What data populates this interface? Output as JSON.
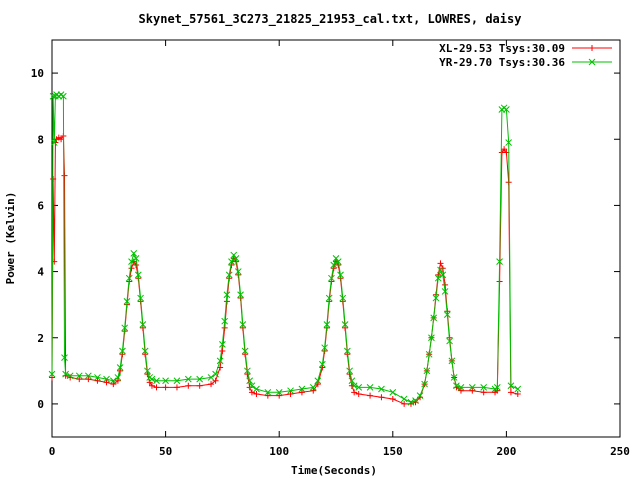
{
  "chart_data": {
    "type": "line",
    "title": "Skynet_57561_3C273_21825_21953_cal.txt, LOWRES, daisy",
    "xlabel": "Time(Seconds)",
    "ylabel": "Power (Kelvin)",
    "xlim": [
      0,
      250
    ],
    "ylim": [
      -1,
      11
    ],
    "xticks": [
      "0",
      "50",
      "100",
      "150",
      "200",
      "250"
    ],
    "yticks": [
      "0",
      "2",
      "4",
      "6",
      "8",
      "10"
    ],
    "legend_position": "top-right",
    "grid": false,
    "series": [
      {
        "name": "XL-29.53 Tsys:30.09",
        "color": "#ff0000",
        "marker": "plus",
        "x": [
          0,
          0.5,
          1,
          1.5,
          2,
          3,
          4,
          5,
          5.5,
          6,
          8,
          12,
          16,
          20,
          24,
          27,
          29,
          30,
          31,
          32,
          33,
          34,
          35,
          36,
          37,
          38,
          39,
          40,
          41,
          42,
          43,
          44,
          46,
          50,
          55,
          60,
          65,
          70,
          72,
          74,
          75,
          76,
          77,
          78,
          79,
          80,
          81,
          82,
          83,
          84,
          85,
          86,
          87,
          88,
          90,
          95,
          100,
          105,
          110,
          115,
          117,
          119,
          120,
          121,
          122,
          123,
          124,
          125,
          126,
          127,
          128,
          129,
          130,
          131,
          132,
          133,
          135,
          140,
          145,
          150,
          155,
          158,
          160,
          162,
          164,
          165,
          166,
          167,
          168,
          169,
          170,
          171,
          172,
          173,
          174,
          175,
          176,
          177,
          178,
          180,
          185,
          190,
          195,
          196,
          197,
          198,
          199,
          200,
          201,
          202,
          205
        ],
        "values": [
          0.8,
          6.8,
          4.3,
          7.9,
          8.0,
          8.05,
          8.0,
          8.1,
          6.9,
          0.85,
          0.8,
          0.75,
          0.75,
          0.7,
          0.65,
          0.6,
          0.7,
          1.0,
          1.5,
          2.2,
          3.0,
          3.7,
          4.1,
          4.3,
          4.2,
          3.8,
          3.1,
          2.3,
          1.5,
          0.9,
          0.65,
          0.55,
          0.5,
          0.5,
          0.5,
          0.55,
          0.55,
          0.6,
          0.7,
          1.1,
          1.6,
          2.3,
          3.1,
          3.8,
          4.2,
          4.4,
          4.3,
          3.9,
          3.2,
          2.3,
          1.5,
          0.9,
          0.5,
          0.35,
          0.3,
          0.25,
          0.25,
          0.3,
          0.35,
          0.4,
          0.6,
          1.1,
          1.6,
          2.3,
          3.1,
          3.7,
          4.1,
          4.3,
          4.2,
          3.8,
          3.1,
          2.3,
          1.5,
          0.9,
          0.55,
          0.35,
          0.3,
          0.25,
          0.2,
          0.15,
          0.0,
          0.0,
          0.05,
          0.2,
          0.6,
          1.0,
          1.5,
          2.0,
          2.6,
          3.3,
          3.9,
          4.25,
          4.1,
          3.6,
          2.8,
          2.0,
          1.3,
          0.8,
          0.5,
          0.4,
          0.4,
          0.35,
          0.35,
          0.4,
          3.7,
          7.6,
          7.7,
          7.6,
          6.7,
          0.35,
          0.3
        ]
      },
      {
        "name": "YR-29.70 Tsys:30.36",
        "color": "#00c000",
        "marker": "cross",
        "x": [
          0,
          0.5,
          1,
          1.5,
          2,
          3,
          4,
          5,
          5.5,
          6,
          8,
          12,
          16,
          20,
          24,
          27,
          29,
          30,
          31,
          32,
          33,
          34,
          35,
          36,
          37,
          38,
          39,
          40,
          41,
          42,
          43,
          44,
          46,
          50,
          55,
          60,
          65,
          70,
          72,
          74,
          75,
          76,
          77,
          78,
          79,
          80,
          81,
          82,
          83,
          84,
          85,
          86,
          87,
          88,
          90,
          95,
          100,
          105,
          110,
          115,
          117,
          119,
          120,
          121,
          122,
          123,
          124,
          125,
          126,
          127,
          128,
          129,
          130,
          131,
          132,
          133,
          135,
          140,
          145,
          150,
          155,
          158,
          160,
          162,
          164,
          165,
          166,
          167,
          168,
          169,
          170,
          171,
          172,
          173,
          174,
          175,
          176,
          177,
          178,
          180,
          185,
          190,
          195,
          196,
          197,
          198,
          199,
          200,
          201,
          202,
          205
        ],
        "values": [
          0.9,
          9.3,
          7.9,
          9.3,
          9.35,
          9.3,
          9.35,
          9.3,
          1.4,
          0.9,
          0.85,
          0.85,
          0.85,
          0.8,
          0.75,
          0.7,
          0.8,
          1.1,
          1.6,
          2.3,
          3.1,
          3.8,
          4.3,
          4.55,
          4.4,
          3.9,
          3.2,
          2.4,
          1.6,
          1.0,
          0.8,
          0.75,
          0.7,
          0.7,
          0.7,
          0.75,
          0.75,
          0.8,
          0.9,
          1.3,
          1.8,
          2.5,
          3.3,
          3.9,
          4.3,
          4.5,
          4.4,
          4.0,
          3.3,
          2.4,
          1.6,
          1.0,
          0.7,
          0.55,
          0.45,
          0.35,
          0.35,
          0.4,
          0.45,
          0.5,
          0.7,
          1.2,
          1.7,
          2.4,
          3.2,
          3.8,
          4.2,
          4.4,
          4.3,
          3.9,
          3.2,
          2.4,
          1.6,
          1.0,
          0.7,
          0.55,
          0.5,
          0.5,
          0.45,
          0.35,
          0.15,
          0.05,
          0.1,
          0.25,
          0.6,
          1.0,
          1.5,
          2.0,
          2.6,
          3.2,
          3.8,
          4.05,
          3.9,
          3.4,
          2.7,
          1.9,
          1.3,
          0.8,
          0.55,
          0.5,
          0.5,
          0.5,
          0.45,
          0.5,
          4.3,
          8.9,
          8.95,
          8.9,
          7.9,
          0.55,
          0.45
        ]
      }
    ]
  }
}
